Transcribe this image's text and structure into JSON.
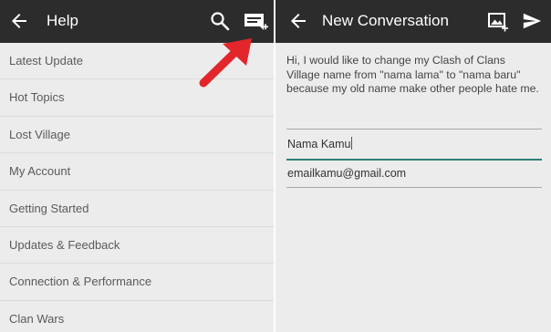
{
  "left_panel": {
    "title": "Help",
    "menu_items": [
      "Latest Update",
      "Hot Topics",
      "Lost Village",
      "My Account",
      "Getting Started",
      "Updates & Feedback",
      "Connection & Performance",
      "Clan Wars"
    ]
  },
  "right_panel": {
    "title": "New Conversation",
    "message": "Hi, I would like to change my Clash of Clans Village name from \"nama lama\" to \"nama baru\" because my old name make other people hate me.",
    "name_value": "Nama Kamu",
    "email_value": "emailkamu@gmail.com"
  },
  "icons": {
    "back": "back-arrow-icon",
    "search": "search-icon",
    "new_conversation": "new-conversation-icon",
    "attach_image": "attach-image-icon",
    "send": "send-icon",
    "annotation": "red-arrow-annotation"
  },
  "colors": {
    "toolbar": "#2c2c2c",
    "background": "#ececec",
    "arrow": "#e2262b",
    "focus_line": "#2f7f78"
  }
}
